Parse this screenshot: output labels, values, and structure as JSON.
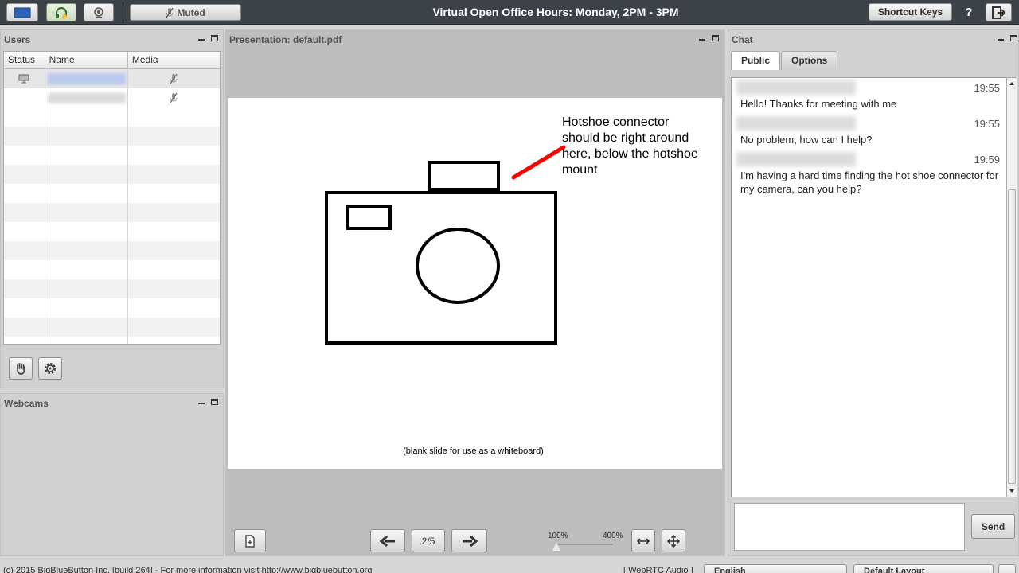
{
  "toolbar": {
    "muted_label": "Muted",
    "meeting_title": "Virtual Open Office Hours: Monday, 2PM - 3PM",
    "shortcut_keys_label": "Shortcut Keys",
    "help_label": "?",
    "icons": [
      "desktop-share-icon",
      "headset-icon",
      "webcam-icon",
      "mic-muted-icon",
      "logout-icon"
    ]
  },
  "users_panel": {
    "title": "Users",
    "columns": [
      "Status",
      "Name",
      "Media"
    ],
    "rows": [
      {
        "status": "presenter",
        "media": "mic-muted"
      },
      {
        "status": "",
        "media": "mic-muted"
      }
    ]
  },
  "webcams_panel": {
    "title": "Webcams"
  },
  "presentation": {
    "title": "Presentation: default.pdf",
    "slide_note": "Hotshoe connector should be right around here, below the hotshoe mount",
    "slide_caption": "(blank slide for use as a whiteboard)",
    "page_indicator": "2/5",
    "zoom_min": "100%",
    "zoom_max": "400%",
    "zoom_level": 0
  },
  "chat": {
    "title": "Chat",
    "tabs": [
      "Public",
      "Options"
    ],
    "messages": [
      {
        "time": "19:55",
        "text": "Hello! Thanks for meeting with me"
      },
      {
        "time": "19:55",
        "text": "No problem, how can I help?"
      },
      {
        "time": "19:59",
        "text": "I'm having a hard time finding the hot shoe connector for my camera, can you help?"
      }
    ],
    "send_label": "Send"
  },
  "footer": {
    "copyright": "(c) 2015 BigBlueButton Inc. [build 264] - For more information visit http://www.bigbluebutton.org",
    "audio": "[ WebRTC Audio ]",
    "language": "English",
    "layout": "Default Layout"
  },
  "colors": {
    "toolbar_bg": "#3d4249",
    "panel_bg": "#d1d1d1",
    "annotation_red": "#ff0000"
  }
}
